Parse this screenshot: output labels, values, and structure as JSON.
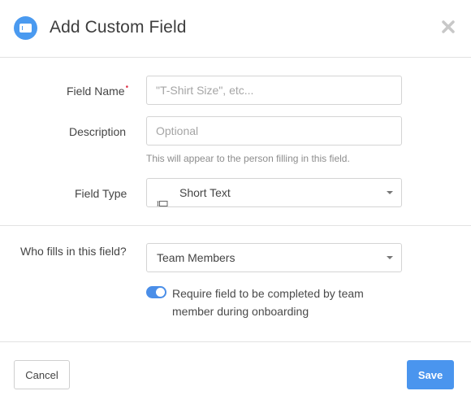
{
  "header": {
    "title": "Add Custom Field",
    "icon": "custom-field-icon",
    "close_icon": "close-icon"
  },
  "form": {
    "field_name": {
      "label": "Field Name",
      "required": true,
      "placeholder": "\"T-Shirt Size\", etc...",
      "value": ""
    },
    "description": {
      "label": "Description",
      "placeholder": "Optional",
      "value": "",
      "hint": "This will appear to the person filling in this field."
    },
    "field_type": {
      "label": "Field Type",
      "value": "Short Text",
      "icon": "short-text-icon"
    },
    "who_fills": {
      "label": "Who fills in this field?",
      "value": "Team Members"
    },
    "require_toggle": {
      "on": true,
      "label": "Require field to be completed by team member during onboarding"
    }
  },
  "footer": {
    "cancel_label": "Cancel",
    "save_label": "Save"
  },
  "colors": {
    "accent": "#4a95ee",
    "required": "#e0344b"
  }
}
